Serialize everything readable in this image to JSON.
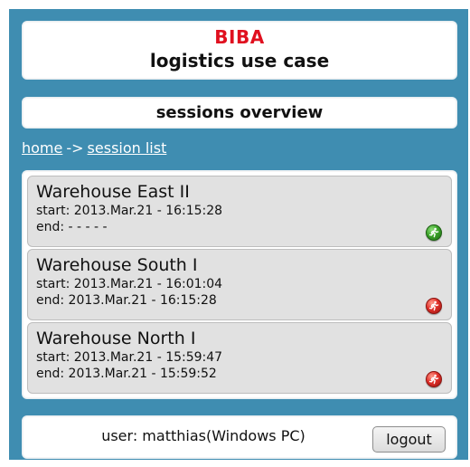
{
  "header": {
    "brand": "BIBA",
    "title": "logistics use case"
  },
  "page": {
    "title": "sessions overview"
  },
  "breadcrumb": {
    "home": "home",
    "separator": "->",
    "current": "session list"
  },
  "sessions": [
    {
      "name": "Warehouse East II",
      "start": "start: 2013.Mar.21 - 16:15:28",
      "end": "end: - - - - -",
      "status": "active",
      "icon": "running-green-icon"
    },
    {
      "name": "Warehouse South I",
      "start": "start: 2013.Mar.21 - 16:01:04",
      "end": "end: 2013.Mar.21 - 16:15:28",
      "status": "ended",
      "icon": "running-red-icon"
    },
    {
      "name": "Warehouse North I",
      "start": "start: 2013.Mar.21 - 15:59:47",
      "end": "end: 2013.Mar.21 - 15:59:52",
      "status": "ended",
      "icon": "running-red-icon"
    }
  ],
  "footer": {
    "user": "user: matthias(Windows PC)",
    "logout_label": "logout"
  },
  "colors": {
    "background": "#3f8db1",
    "brand": "#e0101f",
    "active": "#3ca32a",
    "ended": "#e1302a"
  }
}
